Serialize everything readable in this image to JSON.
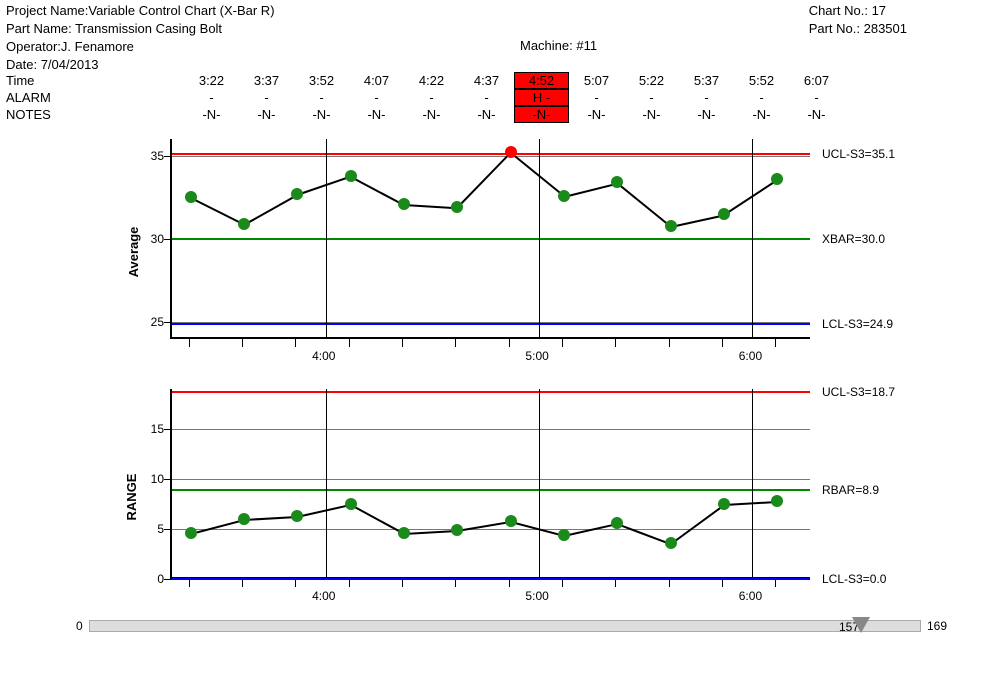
{
  "meta": {
    "project_label": "Project Name:",
    "project": "Variable Control Chart (X-Bar R)",
    "part_label": "Part Name:",
    "part": "Transmission Casing Bolt",
    "operator_label": "Operator:",
    "operator": "J. Fenamore",
    "date_label": "Date:",
    "date": "7/04/2013",
    "machine_label": "Machine:",
    "machine": "#11",
    "chartno_label": "Chart No.:",
    "chartno": "17",
    "partno_label": "Part No.:",
    "partno": "283501"
  },
  "rows": {
    "time_label": "Time",
    "alarm_label": "ALARM",
    "notes_label": "NOTES",
    "times": [
      "3:22",
      "3:37",
      "3:52",
      "4:07",
      "4:22",
      "4:37",
      "4:52",
      "5:07",
      "5:22",
      "5:37",
      "5:52",
      "6:07"
    ],
    "alarms": [
      "-",
      "-",
      "-",
      "-",
      "-",
      "-",
      "H   -",
      "-",
      "-",
      "-",
      "-",
      "-"
    ],
    "notes": [
      "-N-",
      "-N-",
      "-N-",
      "-N-",
      "-N-",
      "-N-",
      "-N-",
      "-N-",
      "-N-",
      "-N-",
      "-N-",
      "-N-"
    ],
    "alarm_col": 6
  },
  "chart_data": [
    {
      "type": "line",
      "name": "average",
      "title": "",
      "ylabel": "Average",
      "ylim": [
        24,
        36
      ],
      "yticks": [
        25,
        30,
        35
      ],
      "x_categories": [
        "3:22",
        "3:37",
        "3:52",
        "4:07",
        "4:22",
        "4:37",
        "4:52",
        "5:07",
        "5:22",
        "5:37",
        "5:52",
        "6:07"
      ],
      "x_major_at": [
        "4:00",
        "5:00",
        "6:00"
      ],
      "values": [
        32.5,
        30.9,
        32.7,
        33.8,
        32.1,
        31.9,
        35.2,
        32.6,
        33.4,
        30.8,
        31.5,
        33.6
      ],
      "limits": {
        "UCL": {
          "label": "UCL-S3=35.1",
          "value": 35.1,
          "color": "#ff0000"
        },
        "CL": {
          "label": "XBAR=30.0",
          "value": 30.0,
          "color": "#008800"
        },
        "LCL": {
          "label": "LCL-S3=24.9",
          "value": 24.9,
          "color": "#0000ff"
        }
      },
      "out_of_control_index": 6
    },
    {
      "type": "line",
      "name": "range",
      "title": "",
      "ylabel": "RANGE",
      "ylim": [
        0,
        19
      ],
      "yticks": [
        0,
        5,
        10,
        15
      ],
      "x_categories": [
        "3:22",
        "3:37",
        "3:52",
        "4:07",
        "4:22",
        "4:37",
        "4:52",
        "5:07",
        "5:22",
        "5:37",
        "5:52",
        "6:07"
      ],
      "x_major_at": [
        "4:00",
        "5:00",
        "6:00"
      ],
      "values": [
        4.6,
        6.0,
        6.3,
        7.5,
        4.6,
        4.9,
        5.8,
        4.4,
        5.6,
        3.6,
        7.5,
        7.8
      ],
      "limits": {
        "UCL": {
          "label": "UCL-S3=18.7",
          "value": 18.7,
          "color": "#ff0000"
        },
        "CL": {
          "label": "RBAR=8.9",
          "value": 8.9,
          "color": "#008800"
        },
        "LCL": {
          "label": "LCL-S3=0.0",
          "value": 0.0,
          "color": "#0000ff"
        }
      },
      "out_of_control_index": -1
    }
  ],
  "slider": {
    "min": 0,
    "max": 169,
    "value": 157
  }
}
